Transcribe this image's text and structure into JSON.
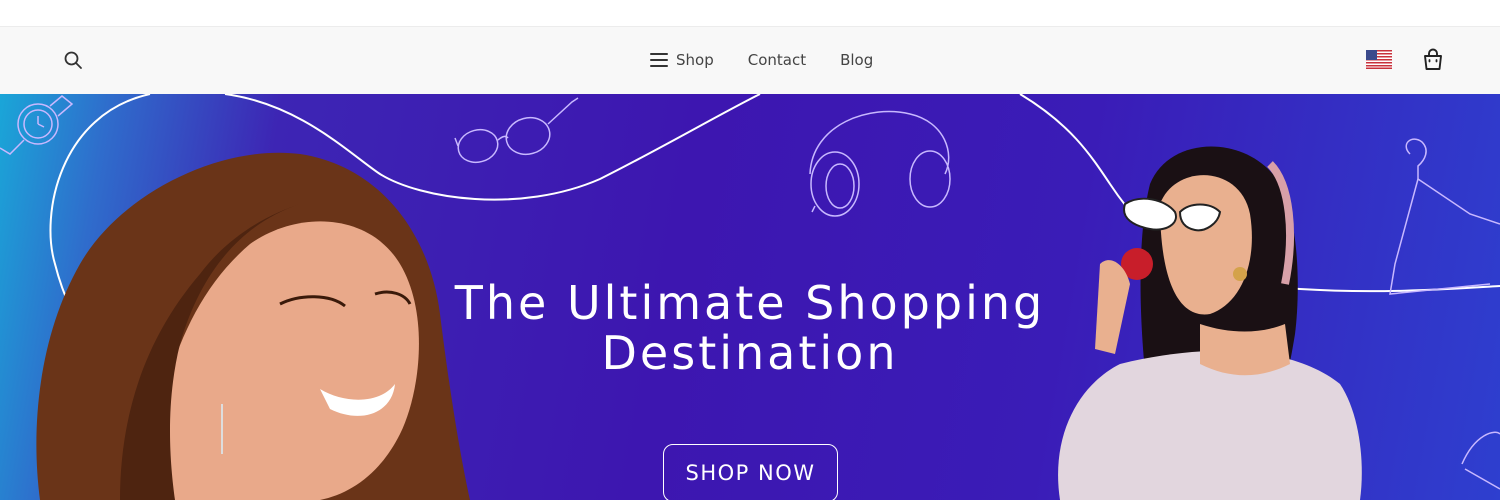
{
  "header": {
    "icons": {
      "search": "search-icon",
      "menu": "menu-icon",
      "flag": "us-flag-icon",
      "cart": "shopping-bag-icon"
    },
    "nav": [
      {
        "label": "Shop"
      },
      {
        "label": "Contact"
      },
      {
        "label": "Blog"
      }
    ]
  },
  "hero": {
    "title_line1": "The Ultimate Shopping",
    "title_line2": "Destination",
    "cta_label": "SHOP NOW",
    "colors": {
      "start": "#1aa6d8",
      "mid": "#3d16b0",
      "end": "#2e3fcf"
    }
  }
}
